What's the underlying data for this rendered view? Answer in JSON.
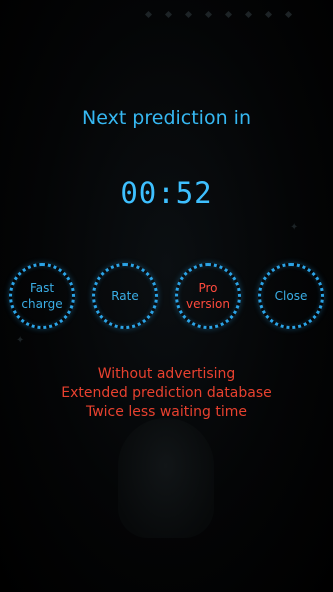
{
  "dialog": {
    "title": "Next prediction in",
    "timer": "00:52"
  },
  "buttons": {
    "fast_charge_line1": "Fast",
    "fast_charge_line2": "charge",
    "rate": "Rate",
    "pro_line1": "Pro",
    "pro_line2": "version",
    "close": "Close"
  },
  "pro_features": [
    "Without advertising",
    "Extended prediction database",
    "Twice less waiting time"
  ],
  "colors": {
    "accent": "#36b8f2",
    "promo": "#e8412f",
    "background": "#000000"
  }
}
